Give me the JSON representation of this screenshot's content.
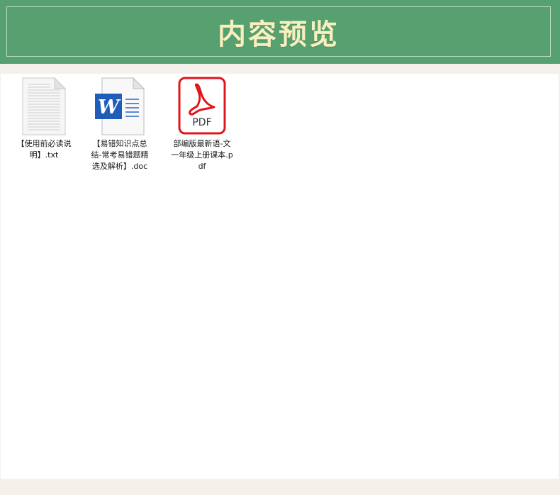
{
  "banner": {
    "title": "内容预览"
  },
  "files": [
    {
      "name": "【使用前必读说明】.txt",
      "icon": "text-file-icon"
    },
    {
      "name": "【易错知识点总结-常考易错题精选及解析】.doc",
      "icon": "word-doc-icon"
    },
    {
      "name": "部编版最新语-文一年级上册课本.pdf",
      "icon": "pdf-file-icon"
    }
  ],
  "pdf_icon_text": "PDF",
  "word_icon_letter": "W",
  "colors": {
    "banner_bg": "#57a170",
    "banner_text": "#f8efbe",
    "page_bg": "#f4f1ea",
    "pdf_red": "#e0161b",
    "word_blue": "#1f5db8"
  }
}
